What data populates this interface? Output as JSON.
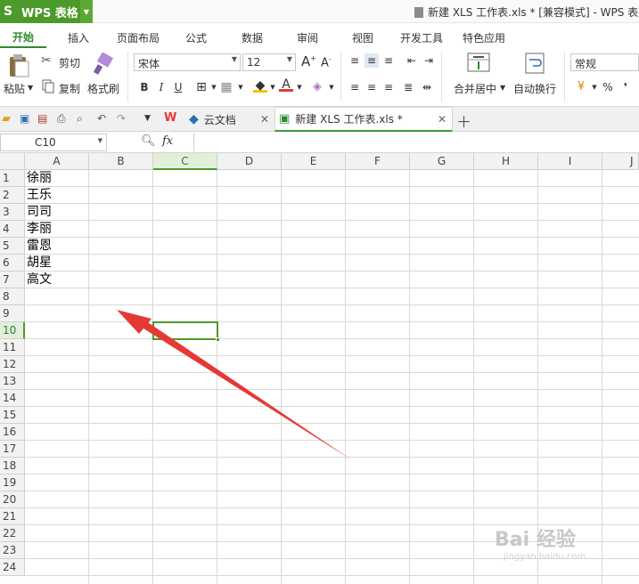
{
  "app": {
    "name": "WPS 表格",
    "logo_letter": "S"
  },
  "window": {
    "title": "新建 XLS 工作表.xls * [兼容模式] - WPS 表"
  },
  "menu": {
    "tabs": [
      "开始",
      "插入",
      "页面布局",
      "公式",
      "数据",
      "审阅",
      "视图",
      "开发工具",
      "特色应用"
    ],
    "active": "开始"
  },
  "ribbon": {
    "paste": "粘贴",
    "cut": "剪切",
    "copy": "复制",
    "format_painter": "格式刷",
    "font_name": "宋体",
    "font_size": "12",
    "merge_center": "合并居中",
    "wrap_text": "自动换行",
    "number_format": "常规",
    "percent": "%",
    "comma": "❜"
  },
  "doc_tabs": [
    {
      "label": "云文档"
    },
    {
      "label": "新建 XLS 工作表.xls *"
    }
  ],
  "formula_bar": {
    "cell_ref": "C10",
    "fx": "fx",
    "formula": ""
  },
  "columns": [
    "A",
    "B",
    "C",
    "D",
    "E",
    "F",
    "G",
    "H",
    "I",
    "J"
  ],
  "selected_column": "C",
  "rows": [
    "1",
    "2",
    "3",
    "4",
    "5",
    "6",
    "7",
    "8",
    "9",
    "10",
    "11",
    "12",
    "13",
    "14",
    "15",
    "16",
    "17",
    "18",
    "19",
    "20",
    "21",
    "22",
    "23",
    "24"
  ],
  "selected_row": "10",
  "cells_column_a": [
    "徐丽",
    "王乐",
    "司司",
    "李丽",
    "雷恩",
    "胡星",
    "高文"
  ],
  "selected_cell": "C10",
  "accent_color": "#4c9a2a",
  "annotation": {
    "type": "arrow",
    "color": "#e53935"
  },
  "watermark": {
    "line1": "Bai 经验",
    "line2": "jingyan.baidu.com"
  }
}
